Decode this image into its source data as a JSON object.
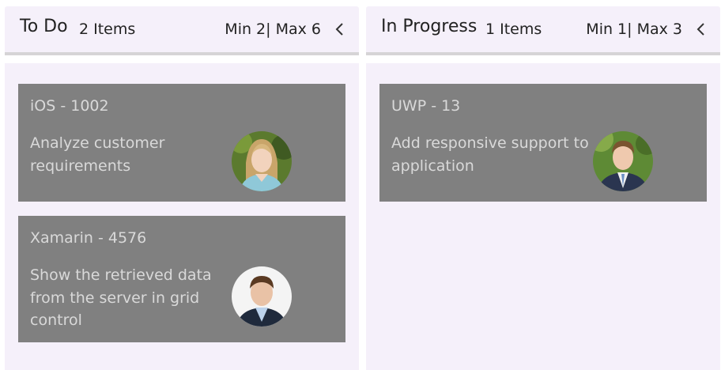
{
  "columns": [
    {
      "title": "To Do",
      "count": "2 Items",
      "limits": "Min 2| Max 6",
      "cards": [
        {
          "title": "iOS - 1002",
          "description": "Analyze customer requirements",
          "avatar": "woman-avatar"
        },
        {
          "title": "Xamarin - 4576",
          "description": "Show the retrieved data from the server in grid control",
          "avatar": "man-avatar"
        }
      ]
    },
    {
      "title": "In Progress",
      "count": "1 Items",
      "limits": "Min 1| Max 3",
      "cards": [
        {
          "title": "UWP - 13",
          "description": "Add responsive support to application",
          "avatar": "man-avatar"
        }
      ]
    }
  ],
  "colors": {
    "column_background": "#f5f0fa",
    "header_underline": "#d6d4d6",
    "card_background": "#808080",
    "card_text": "#d9d9d9"
  },
  "icons": {
    "collapse": "chevron-left-icon"
  }
}
